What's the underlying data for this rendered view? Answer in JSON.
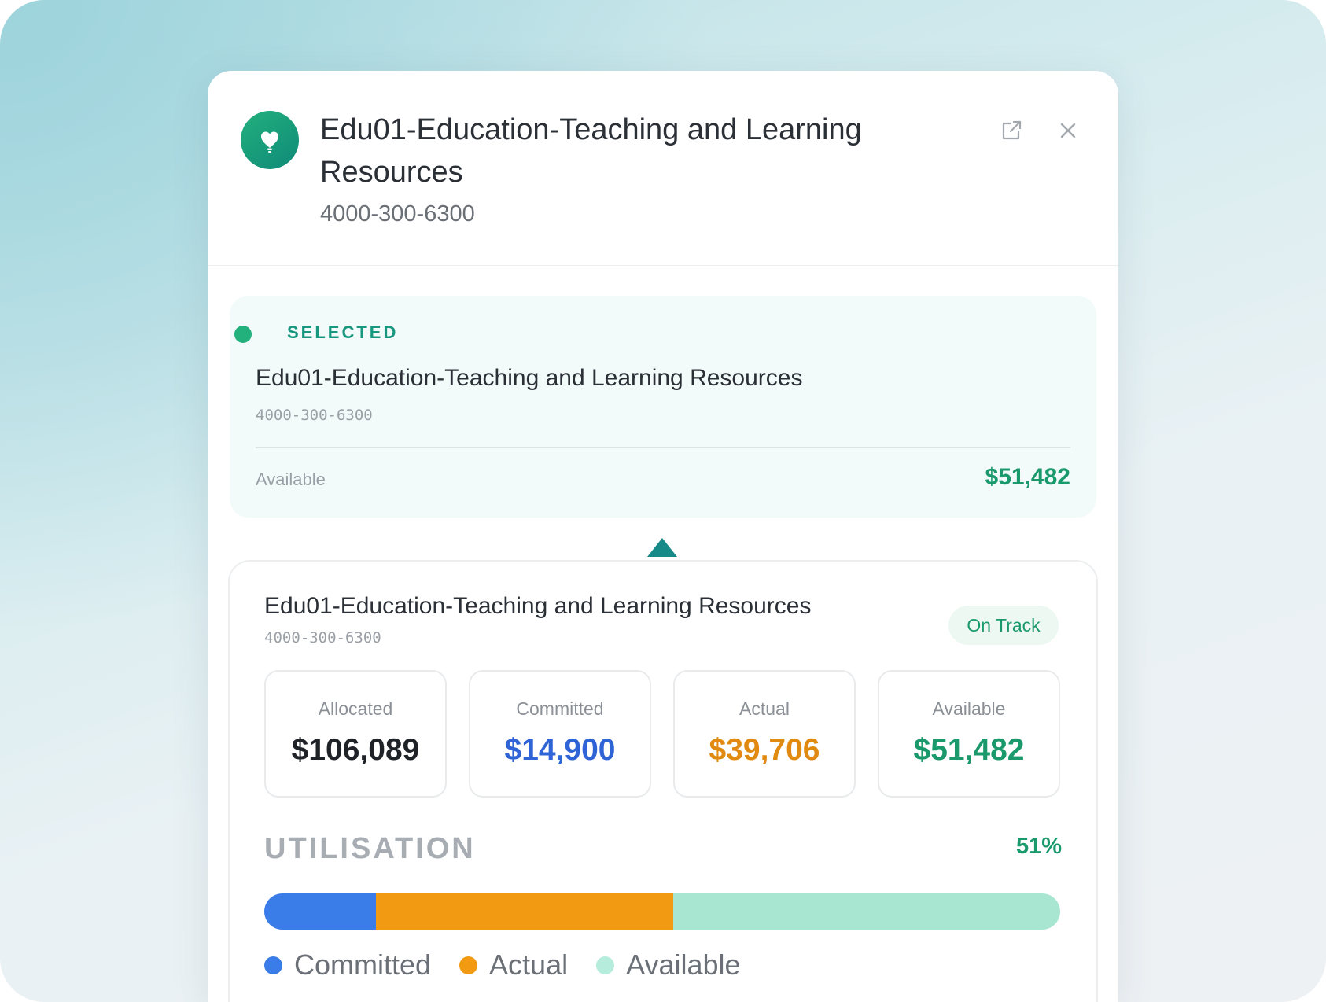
{
  "header": {
    "title": "Edu01-Education-Teaching and Learning Resources",
    "code": "4000-300-6300",
    "logo_icon": "heart-bulb-icon",
    "open_icon": "external-link-icon",
    "close_icon": "close-icon"
  },
  "selected": {
    "status_label": "SELECTED",
    "title": "Edu01-Education-Teaching and Learning Resources",
    "code": "4000-300-6300",
    "available_label": "Available",
    "available_value": "$51,482"
  },
  "detail": {
    "title": "Edu01-Education-Teaching and Learning Resources",
    "code": "4000-300-6300",
    "status_badge": "On Track",
    "stats": [
      {
        "label": "Allocated",
        "value": "$106,089",
        "color": "#1f2328"
      },
      {
        "label": "Committed",
        "value": "$14,900",
        "color": "#2f64d6"
      },
      {
        "label": "Actual",
        "value": "$39,706",
        "color": "#e08a12"
      },
      {
        "label": "Available",
        "value": "$51,482",
        "color": "#1a9a6c"
      }
    ],
    "utilisation": {
      "label": "UTILISATION",
      "percent": "51%",
      "segments": [
        {
          "name": "Committed",
          "fraction": 0.14,
          "color": "#3b7de8"
        },
        {
          "name": "Actual",
          "fraction": 0.374,
          "color": "#f29a12"
        },
        {
          "name": "Available",
          "fraction": 0.486,
          "color": "#a8e6d1"
        }
      ]
    },
    "legend": [
      {
        "label": "Committed",
        "color": "#3b7de8"
      },
      {
        "label": "Actual",
        "color": "#f29a12"
      },
      {
        "label": "Available",
        "color": "#b5ecdb"
      }
    ]
  },
  "colors": {
    "accent": "#22b07d",
    "brand_dark": "#0f8a78"
  }
}
